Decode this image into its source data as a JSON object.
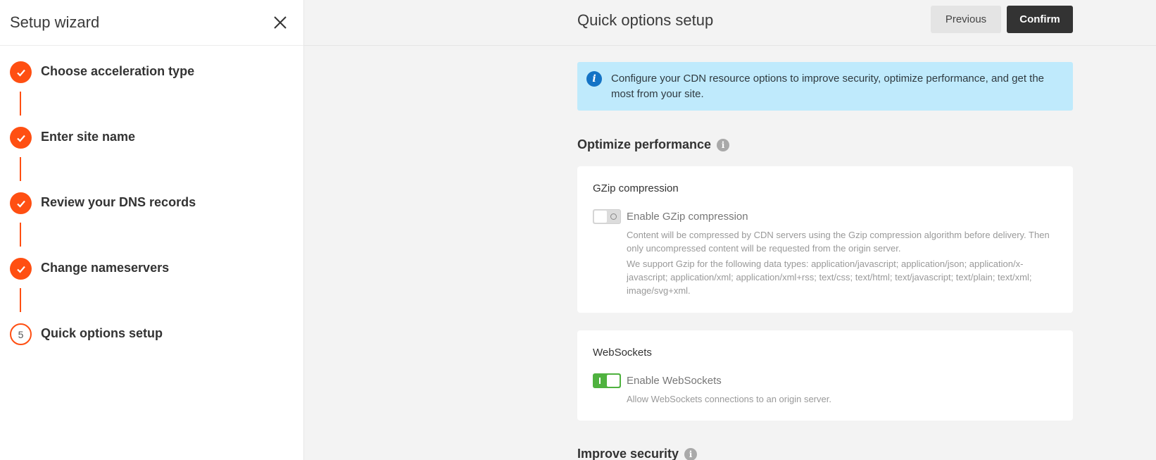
{
  "sidebar": {
    "title": "Setup wizard",
    "steps": [
      {
        "label": "Choose acceleration type",
        "status": "done"
      },
      {
        "label": "Enter site name",
        "status": "done"
      },
      {
        "label": "Review your DNS records",
        "status": "done"
      },
      {
        "label": "Change nameservers",
        "status": "done"
      },
      {
        "label": "Quick options setup",
        "status": "current",
        "number": "5"
      }
    ]
  },
  "header": {
    "title": "Quick options setup",
    "previous_label": "Previous",
    "confirm_label": "Confirm"
  },
  "info": {
    "text": "Configure your CDN resource options to improve security, optimize performance, and get the most from your site."
  },
  "optimize": {
    "title": "Optimize performance",
    "gzip": {
      "title": "GZip compression",
      "toggle_label": "Enable GZip compression",
      "enabled": false,
      "desc1": "Content will be compressed by CDN servers using the Gzip compression algorithm before delivery. Then only uncompressed content will be requested from the origin server.",
      "desc2": "We support Gzip for the following data types: application/javascript; application/json; application/x-javascript; application/xml; application/xml+rss; text/css; text/html; text/javascript; text/plain; text/xml; image/svg+xml."
    },
    "websockets": {
      "title": "WebSockets",
      "toggle_label": "Enable WebSockets",
      "enabled": true,
      "desc": "Allow WebSockets connections to an origin server."
    }
  },
  "security": {
    "title": "Improve security"
  },
  "colors": {
    "accent": "#ff4f12",
    "info_bg": "#bfeafc",
    "toggle_on": "#4fb23f",
    "confirm_bg": "#333333"
  }
}
